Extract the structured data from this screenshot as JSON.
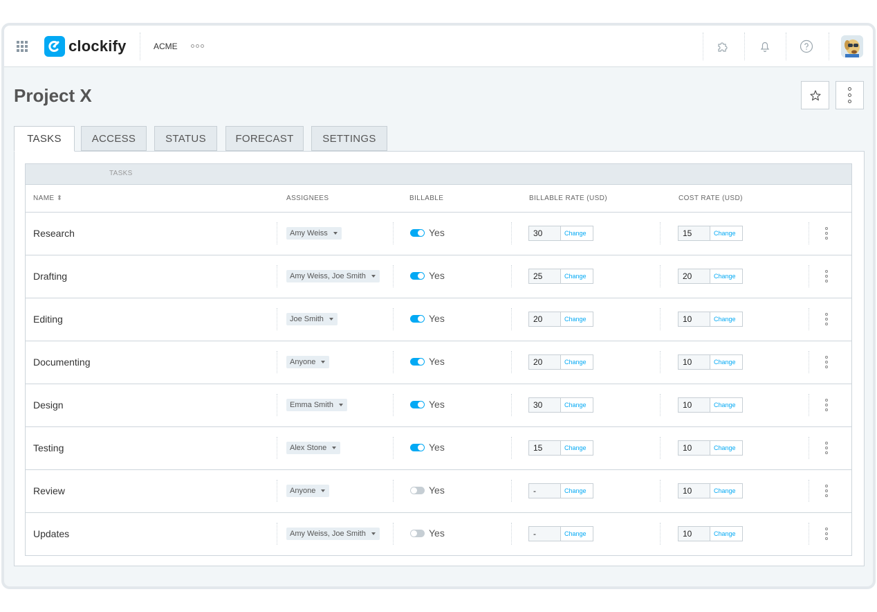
{
  "topbar": {
    "logo_text": "clockify",
    "workspace": "ACME"
  },
  "page": {
    "title": "Project X"
  },
  "tabs": [
    {
      "label": "TASKS",
      "active": true
    },
    {
      "label": "ACCESS",
      "active": false
    },
    {
      "label": "STATUS",
      "active": false
    },
    {
      "label": "FORECAST",
      "active": false
    },
    {
      "label": "SETTINGS",
      "active": false
    }
  ],
  "table": {
    "section_label": "TASKS",
    "columns": {
      "name": "NAME",
      "assignees": "ASSIGNEES",
      "billable": "BILLABLE",
      "billable_rate": "BILLABLE RATE (USD)",
      "cost_rate": "COST RATE (USD)"
    },
    "change_label": "Change",
    "billable_label": "Yes",
    "rows": [
      {
        "name": "Research",
        "assignees": "Amy Weiss",
        "billable_on": true,
        "billable_rate": "30",
        "cost_rate": "15"
      },
      {
        "name": "Drafting",
        "assignees": "Amy Weiss, Joe Smith",
        "billable_on": true,
        "billable_rate": "25",
        "cost_rate": "20"
      },
      {
        "name": "Editing",
        "assignees": "Joe Smith",
        "billable_on": true,
        "billable_rate": "20",
        "cost_rate": "10"
      },
      {
        "name": "Documenting",
        "assignees": "Anyone",
        "billable_on": true,
        "billable_rate": "20",
        "cost_rate": "10"
      },
      {
        "name": "Design",
        "assignees": "Emma Smith",
        "billable_on": true,
        "billable_rate": "30",
        "cost_rate": "10"
      },
      {
        "name": "Testing",
        "assignees": "Alex Stone",
        "billable_on": true,
        "billable_rate": "15",
        "cost_rate": "10"
      },
      {
        "name": "Review",
        "assignees": "Anyone",
        "billable_on": false,
        "billable_rate": "-",
        "cost_rate": "10"
      },
      {
        "name": "Updates",
        "assignees": "Amy Weiss, Joe Smith",
        "billable_on": false,
        "billable_rate": "-",
        "cost_rate": "10"
      }
    ]
  },
  "colors": {
    "accent": "#03a9f4",
    "toggle_off": "#c6ced4"
  }
}
